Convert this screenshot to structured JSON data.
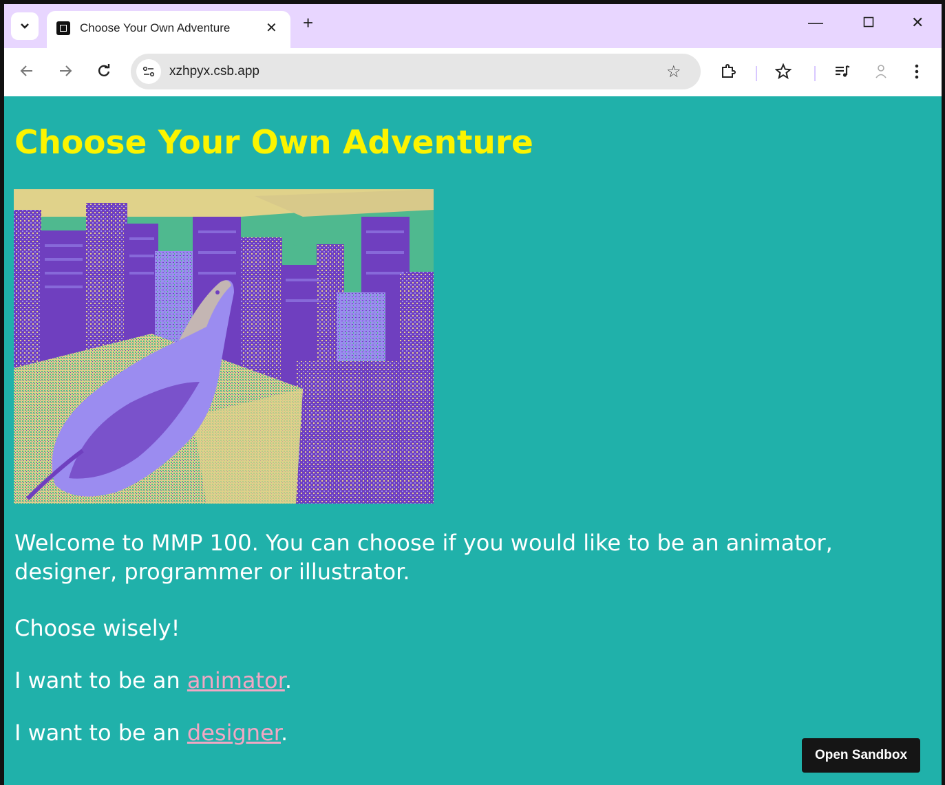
{
  "browser": {
    "tab_title": "Choose Your Own Adventure",
    "url": "xzhpyx.csb.app"
  },
  "icons": {
    "tab_search": "chevron-down-icon",
    "close": "close-icon",
    "new_tab": "plus-icon",
    "minimize": "minimize-icon",
    "maximize": "maximize-icon",
    "window_close": "close-icon",
    "back": "arrow-left-icon",
    "forward": "arrow-right-icon",
    "reload": "reload-icon",
    "site_info": "tune-icon",
    "bookmark": "star-icon",
    "extensions": "puzzle-icon",
    "bookmarks": "star-list-icon",
    "media": "media-queue-icon",
    "profile": "profile-icon",
    "menu": "kebab-menu-icon"
  },
  "page": {
    "heading": "Choose Your Own Adventure",
    "image_alt": "Pigeon on a ledge overlooking a city, posterized in purple, teal and yellow",
    "welcome_text": "Welcome to MMP 100. You can choose if you would like to be an animator, designer, programmer or illustrator.",
    "choose_text": "Choose wisely!",
    "animator_prefix": "I want to be an ",
    "animator_link": "animator",
    "animator_suffix": ".",
    "designer_prefix": "I want to be an ",
    "designer_link": "designer",
    "designer_suffix": ".",
    "open_sandbox": "Open Sandbox"
  },
  "colors": {
    "page_background": "#20b1aa",
    "heading": "#fcf400",
    "link": "#f2a7c4",
    "tabstrip": "#e8d6ff"
  }
}
